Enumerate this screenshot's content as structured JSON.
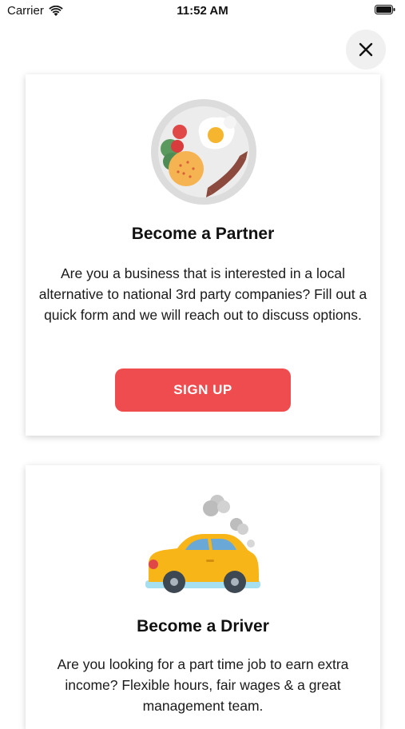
{
  "status_bar": {
    "carrier": "Carrier",
    "time": "11:52 AM"
  },
  "icons": {
    "close": "close-icon",
    "wifi": "wifi-icon",
    "battery": "battery-icon",
    "food_plate": "food-plate-icon",
    "car": "car-icon"
  },
  "partner_card": {
    "title": "Become a Partner",
    "description": "Are you a business that is interested in a local alternative to national 3rd party companies? Fill out a quick form and we will reach out to discuss options.",
    "button_label": "SIGN UP"
  },
  "driver_card": {
    "title": "Become a Driver",
    "description": "Are you looking for a part time job to earn extra income? Flexible hours, fair wages & a great management team."
  },
  "colors": {
    "accent": "#ef4c4f",
    "background": "#ffffff",
    "close_button_bg": "#f0f0f0"
  }
}
